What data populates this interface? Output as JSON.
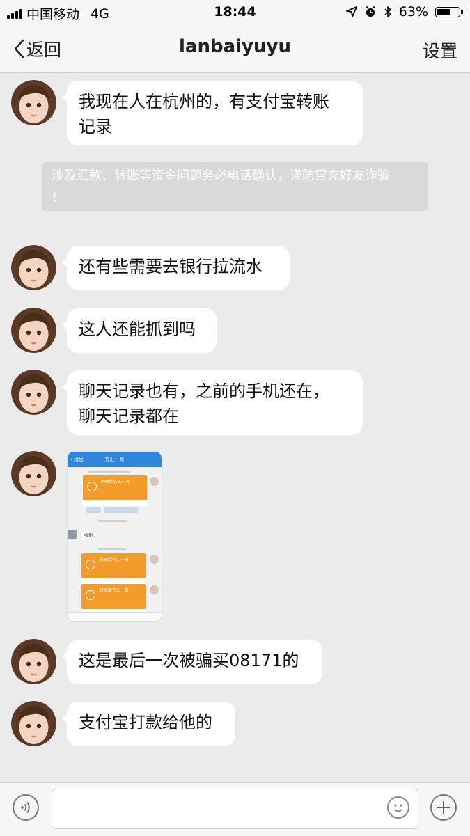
{
  "status_bar": {
    "carrier": "中国移动",
    "network": "4G",
    "time": "18:44",
    "battery_percent": "63%",
    "battery_level": 0.63,
    "icons": [
      "signal-icon",
      "location-arrow-icon",
      "alarm-icon",
      "bluetooth-icon",
      "battery-icon"
    ]
  },
  "nav": {
    "back_label": "返回",
    "title": "lanbaiyuyu",
    "settings_label": "设置"
  },
  "messages": [
    {
      "sender": "other",
      "type": "text",
      "lines": [
        "我现在人在杭州的，有支付宝转账",
        "记录"
      ]
    },
    {
      "type": "notice",
      "lines": [
        "涉及汇款、转账等资金问题务必电话确认，谨防冒充好友诈骗",
        "！"
      ]
    },
    {
      "sender": "other",
      "type": "text",
      "lines": [
        "还有些需要去银行拉流水"
      ]
    },
    {
      "sender": "other",
      "type": "text",
      "lines": [
        "这人还能抓到吗"
      ]
    },
    {
      "sender": "other",
      "type": "text",
      "lines": [
        "聊天记录也有，之前的手机还在，",
        "聊天记录都在"
      ]
    },
    {
      "sender": "other",
      "type": "image",
      "screenshot": {
        "back": "‹ 消息",
        "title": "齐汇一哥",
        "receive_label": "收到",
        "cards": [
          "转账给齐汇一哥",
          "转账给齐汇一哥",
          "转账给齐汇一哥"
        ]
      }
    },
    {
      "sender": "other",
      "type": "text",
      "lines": [
        "这是最后一次被骗买08171的"
      ]
    },
    {
      "sender": "other",
      "type": "text",
      "lines": [
        "支付宝打款给他的"
      ]
    }
  ],
  "input_bar": {
    "icons": [
      "voice-icon",
      "emoji-icon",
      "plus-icon"
    ],
    "placeholder": ""
  },
  "colors": {
    "chat_background": "#ebebeb",
    "bubble_background": "#ffffff",
    "notice_background": "#d9d9d9",
    "bar_background": "#f7f7f7"
  }
}
